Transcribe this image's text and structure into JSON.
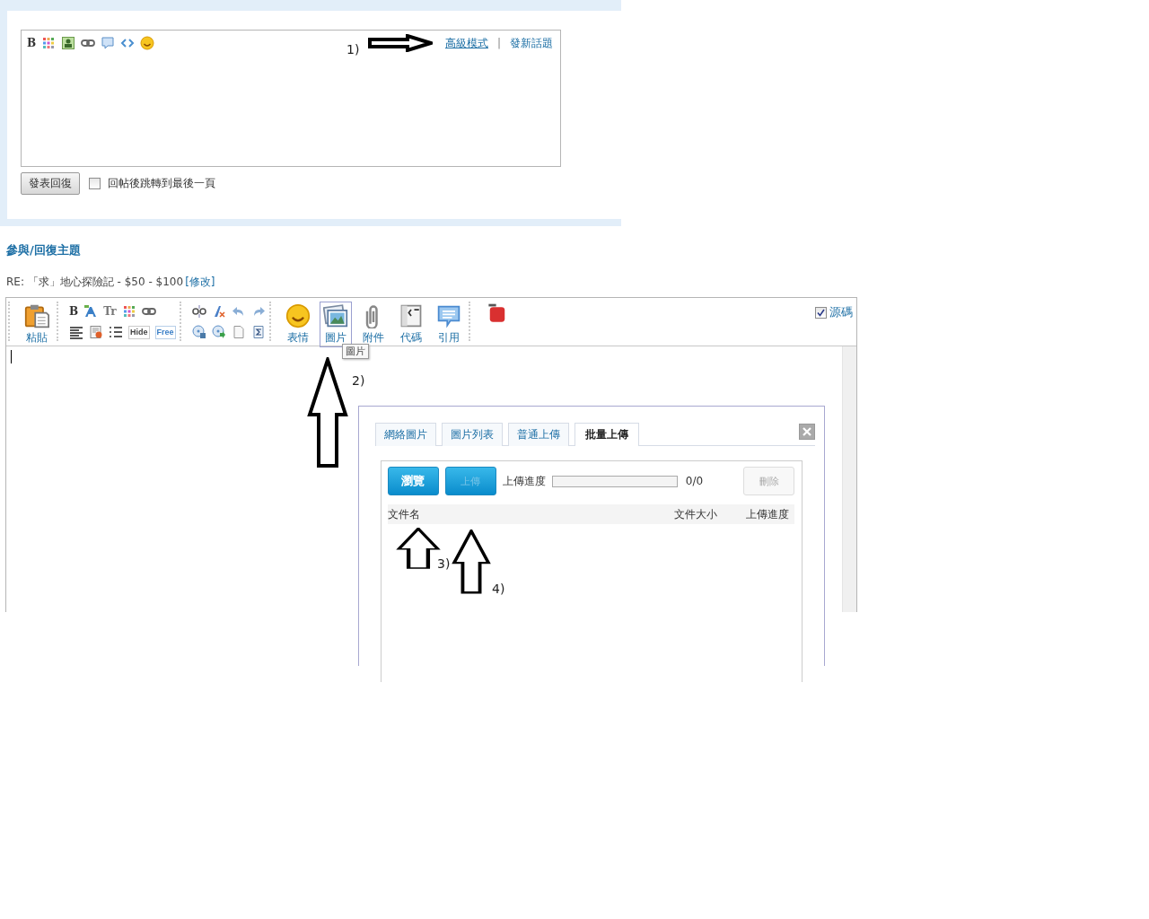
{
  "quick_reply": {
    "toolbar": [
      {
        "kind": "bold",
        "glyph": "B"
      },
      {
        "kind": "color"
      },
      {
        "kind": "image"
      },
      {
        "kind": "link"
      },
      {
        "kind": "bubble"
      },
      {
        "kind": "code"
      },
      {
        "kind": "smiley"
      }
    ],
    "links": [
      "高級模式",
      "發新話題"
    ],
    "separator": "|",
    "submit": "發表回復",
    "jump_option": {
      "label": "回帖後跳轉到最後一頁",
      "checked": false
    }
  },
  "reply_section": {
    "heading": "參與/回復主題",
    "subject": "RE: 「求」地心探險記 - $50 - $100",
    "edit_link": "[修改]"
  },
  "editor": {
    "toolbar_groups": [
      {
        "kind": "large",
        "items": [
          {
            "kind": "paste",
            "label": "粘貼",
            "selected": false
          }
        ]
      },
      {
        "kind": "small",
        "rows": [
          [
            {
              "kind": "bold",
              "glyph": "B"
            },
            {
              "kind": "font"
            },
            {
              "kind": "size",
              "glyph": "Tr"
            },
            {
              "kind": "color"
            },
            {
              "kind": "link"
            }
          ],
          [
            {
              "kind": "align"
            },
            {
              "kind": "float"
            },
            {
              "kind": "list"
            },
            {
              "kind": "hide",
              "glyph": "Hide"
            },
            {
              "kind": "free",
              "glyph": "Free"
            }
          ]
        ]
      },
      {
        "kind": "small",
        "rows": [
          [
            {
              "kind": "unlink"
            },
            {
              "kind": "clear"
            },
            {
              "kind": "undo"
            },
            {
              "kind": "redo"
            }
          ],
          [
            {
              "kind": "media"
            },
            {
              "kind": "flash"
            },
            {
              "kind": "page"
            },
            {
              "kind": "sigma"
            }
          ]
        ]
      },
      {
        "kind": "large",
        "items": [
          {
            "kind": "smiley",
            "label": "表情",
            "selected": false
          },
          {
            "kind": "image",
            "label": "圖片",
            "selected": true
          },
          {
            "kind": "attach",
            "label": "附件",
            "selected": false
          },
          {
            "kind": "code",
            "label": "代碼",
            "selected": false
          },
          {
            "kind": "quote",
            "label": "引用",
            "selected": false
          }
        ]
      },
      {
        "kind": "large",
        "items": [
          {
            "kind": "video",
            "selected": false
          }
        ]
      }
    ],
    "source_mode": {
      "label": "源碼",
      "checked": true
    },
    "tooltip": "圖片"
  },
  "image_dialog": {
    "tabs": [
      {
        "label": "網絡圖片",
        "selected": false
      },
      {
        "label": "圖片列表",
        "selected": false
      },
      {
        "label": "普通上傳",
        "selected": false
      },
      {
        "label": "批量上傳",
        "selected": true
      }
    ],
    "browse": "瀏覽",
    "upload": {
      "label": "上傳",
      "disabled": true
    },
    "progress_label": "上傳進度",
    "progress": {
      "level": 0
    },
    "count": "0/0",
    "delete": {
      "label": "刪除",
      "disabled": true
    },
    "columns": [
      "文件名",
      "文件大小",
      "上傳進度"
    ]
  },
  "annotations": [
    {
      "label": "1)",
      "kind": "right"
    },
    {
      "label": "2)",
      "kind": "up"
    },
    {
      "label": "3)",
      "kind": "up"
    },
    {
      "label": "4)",
      "kind": "up"
    }
  ]
}
